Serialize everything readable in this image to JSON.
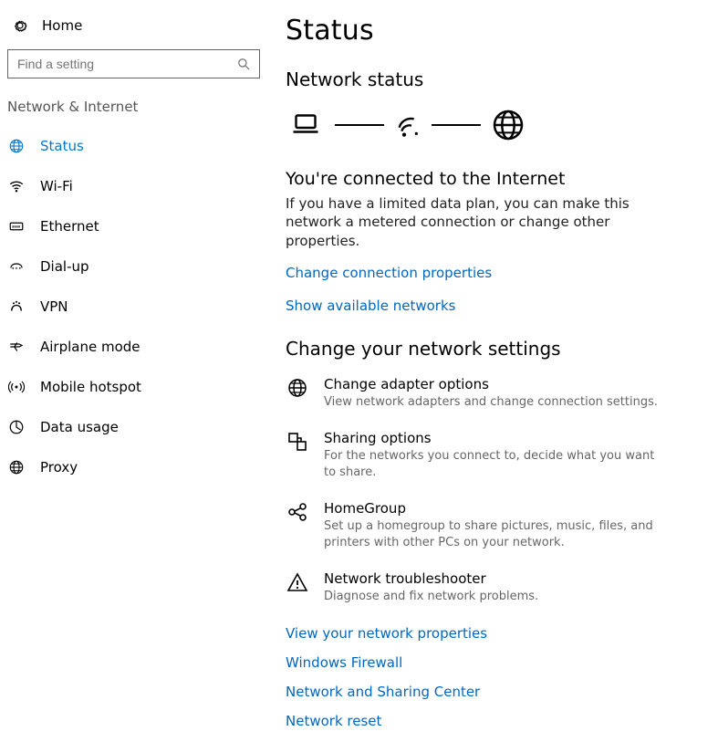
{
  "colors": {
    "accent": "#0078D7",
    "link": "#0067C0"
  },
  "home_label": "Home",
  "search_placeholder": "Find a setting",
  "section_title": "Network & Internet",
  "sidebar": [
    {
      "icon": "status-icon",
      "label": "Status",
      "active": true
    },
    {
      "icon": "wifi-icon",
      "label": "Wi-Fi",
      "active": false
    },
    {
      "icon": "ethernet-icon",
      "label": "Ethernet",
      "active": false
    },
    {
      "icon": "dialup-icon",
      "label": "Dial-up",
      "active": false
    },
    {
      "icon": "vpn-icon",
      "label": "VPN",
      "active": false
    },
    {
      "icon": "airplane-icon",
      "label": "Airplane mode",
      "active": false
    },
    {
      "icon": "hotspot-icon",
      "label": "Mobile hotspot",
      "active": false
    },
    {
      "icon": "datausage-icon",
      "label": "Data usage",
      "active": false
    },
    {
      "icon": "proxy-icon",
      "label": "Proxy",
      "active": false
    }
  ],
  "page_title": "Status",
  "network_status_heading": "Network status",
  "connected_title": "You're connected to the Internet",
  "connected_body": "If you have a limited data plan, you can make this network a metered connection or change other properties.",
  "link_change_props": "Change connection properties",
  "link_show_networks": "Show available networks",
  "change_settings_heading": "Change your network settings",
  "settings": [
    {
      "icon": "adapter-icon",
      "title": "Change adapter options",
      "desc": "View network adapters and change connection settings."
    },
    {
      "icon": "sharing-icon",
      "title": "Sharing options",
      "desc": "For the networks you connect to, decide what you want to share."
    },
    {
      "icon": "homegroup-icon",
      "title": "HomeGroup",
      "desc": "Set up a homegroup to share pictures, music, files, and printers with other PCs on your network."
    },
    {
      "icon": "trouble-icon",
      "title": "Network troubleshooter",
      "desc": "Diagnose and fix network problems."
    }
  ],
  "bottom_links": [
    "View your network properties",
    "Windows Firewall",
    "Network and Sharing Center",
    "Network reset"
  ]
}
